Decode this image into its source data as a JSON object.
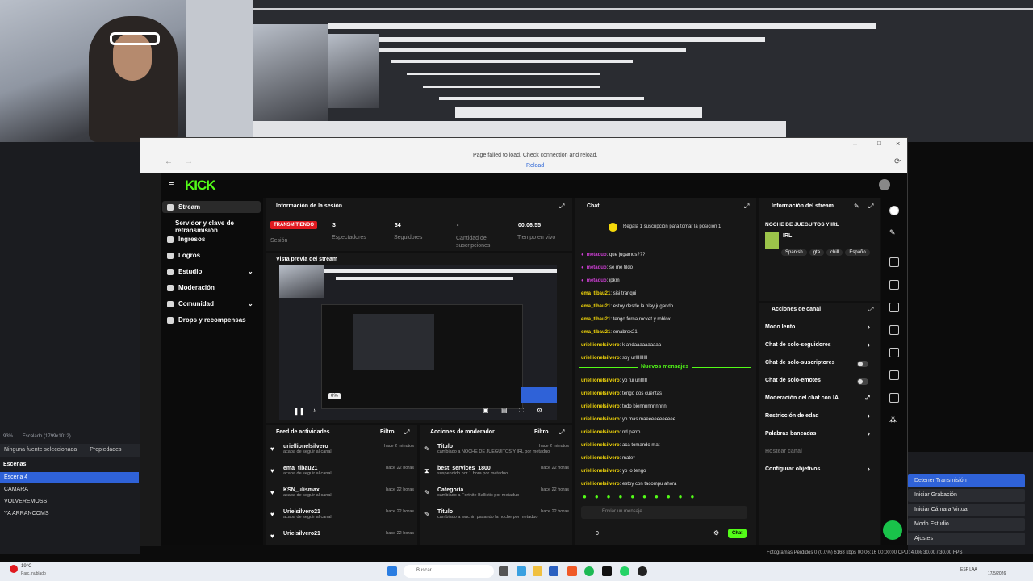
{
  "browser": {
    "error": "Page failed to load. Check connection and reload.",
    "reload": "Reload"
  },
  "obs": {
    "status": "Escalado (1799x1012)",
    "props_none": "Ninguna fuente seleccionada",
    "props": "Propiedades",
    "scenes_title": "Escenas",
    "scenes": [
      "Escena 4",
      "CAMARA",
      "VOLVEREMOSS",
      "YA ARRANCOMS"
    ],
    "controls": [
      "Detener Transmisión",
      "Iniciar Grabación",
      "Iniciar Cámara Virtual",
      "Modo Estudio",
      "Ajustes"
    ],
    "stats": "Fotogramas Perdidos 0 (0.0%)   6168 kbps   00:06:16   00:00:00   CPU: 4.0%   30.00 / 30.00 FPS",
    "zoom": "93%"
  },
  "sidebar": {
    "items": [
      "Stream",
      "Servidor y clave de retransmisión",
      "Ingresos",
      "Logros",
      "Estudio",
      "Moderación",
      "Comunidad",
      "Drops y recompensas"
    ]
  },
  "session": {
    "title": "Información de la sesión",
    "live": "TRANSMITIENDO",
    "sesion": "Sesión",
    "stats": [
      {
        "v": "3",
        "l": "Espectadores"
      },
      {
        "v": "34",
        "l": "Seguidores"
      },
      {
        "v": "-",
        "l": "Cantidad de suscripciones"
      },
      {
        "v": "00:06:55",
        "l": "Tiempo en vivo"
      }
    ]
  },
  "preview": {
    "title": "Vista previa del stream",
    "volume": "0%"
  },
  "feed": {
    "title": "Feed de actividades",
    "filter": "Filtro",
    "items": [
      {
        "n": "uriellionelsilvero",
        "s": "acaba de seguir al canal",
        "t": "hace 2 minutos"
      },
      {
        "n": "ema_tibau21",
        "s": "acaba de seguir al canal",
        "t": "hace 22 horas"
      },
      {
        "n": "KSN_ulismax",
        "s": "acaba de seguir al canal",
        "t": "hace 22 horas"
      },
      {
        "n": "Urielsilvero21",
        "s": "acaba de seguir al canal",
        "t": "hace 22 horas"
      },
      {
        "n": "Urielsilvero21",
        "s": "",
        "t": "hace 22 horas"
      }
    ]
  },
  "modactions": {
    "title": "Acciones de moderador",
    "filter": "Filtro",
    "items": [
      {
        "n": "Título",
        "s": "cambiado a NOCHE DE JUEGUITOS Y IRL por metaduo",
        "t": "hace 2 minutos"
      },
      {
        "n": "best_services_1800",
        "s": "suspendido por 1 hora por metaduo",
        "t": "hace 22 horas"
      },
      {
        "n": "Categoría",
        "s": "cambiado a Fortnite Ballistic por metaduo",
        "t": "hace 22 horas"
      },
      {
        "n": "Título",
        "s": "cambiado a wachin pasando la noche por metaduo",
        "t": "hace 22 horas"
      }
    ]
  },
  "chat": {
    "title": "Chat",
    "gift": "Regala 1 suscripción para tomar la posición 1",
    "new": "Nuevos mensajes",
    "placeholder": "Enviar un mensaje",
    "send": "Chat",
    "count": "0",
    "msgs": [
      {
        "u": "metaduo",
        "m": "que jugamos???",
        "c": "p"
      },
      {
        "u": "metaduo",
        "m": "se me tildo",
        "c": "p"
      },
      {
        "u": "metaduo",
        "m": "ipkm",
        "c": "p"
      },
      {
        "u": "ema_tibau21",
        "m": "sisi tranqui",
        "c": "y"
      },
      {
        "u": "ema_tibau21",
        "m": "estoy desde la play jugando",
        "c": "y"
      },
      {
        "u": "ema_tibau21",
        "m": "tengo forna,rocket y roblox",
        "c": "y"
      },
      {
        "u": "ema_tibau21",
        "m": "emabrox21",
        "c": "y"
      },
      {
        "u": "uriellionelsilvero",
        "m": "k andaaaaaaaaaa",
        "c": "y"
      },
      {
        "u": "uriellionelsilvero",
        "m": "soy urIIIIIIIII",
        "c": "y"
      },
      {
        "u": "uriellionelsilvero",
        "m": "yo fui uriIIIII",
        "c": "y"
      },
      {
        "u": "uriellionelsilvero",
        "m": "tengo dos cuentas",
        "c": "y"
      },
      {
        "u": "uriellionelsilvero",
        "m": "todo biennnnnnnnnn",
        "c": "y"
      },
      {
        "u": "uriellionelsilvero",
        "m": "yo mas maeeeeeeeeeee",
        "c": "y"
      },
      {
        "u": "uriellionelsilvero",
        "m": "nd parro",
        "c": "y"
      },
      {
        "u": "uriellionelsilvero",
        "m": "aca tomando mat",
        "c": "y"
      },
      {
        "u": "uriellionelsilvero",
        "m": "mate*",
        "c": "y"
      },
      {
        "u": "uriellionelsilvero",
        "m": "yo lo tengo",
        "c": "y"
      },
      {
        "u": "uriellionelsilvero",
        "m": "estoy con tacompu ahora",
        "c": "y"
      }
    ]
  },
  "streaminfo": {
    "title": "Información del stream",
    "name": "NOCHE DE JUEGUITOS Y IRL",
    "category": "IRL",
    "tags": [
      "Spanish",
      "gta",
      "chill",
      "Españo"
    ]
  },
  "channel": {
    "title": "Acciones de canal",
    "items": [
      {
        "l": "Modo lento",
        "k": "chev"
      },
      {
        "l": "Chat de solo-seguidores",
        "k": "chev"
      },
      {
        "l": "Chat de solo-suscriptores",
        "k": "toggle"
      },
      {
        "l": "Chat de solo-emotes",
        "k": "toggle"
      },
      {
        "l": "Moderación del chat con IA",
        "k": "ext"
      },
      {
        "l": "Restricción de edad",
        "k": "chev"
      },
      {
        "l": "Palabras baneadas",
        "k": "chev"
      },
      {
        "l": "Hostear canal",
        "k": "dim"
      },
      {
        "l": "Configurar objetivos",
        "k": "chev"
      }
    ]
  },
  "taskbar": {
    "search": "Buscar",
    "weather": "19°C",
    "weather_desc": "Parc. nublado",
    "lang": "ESP LAA",
    "time": "17/5/2026"
  }
}
